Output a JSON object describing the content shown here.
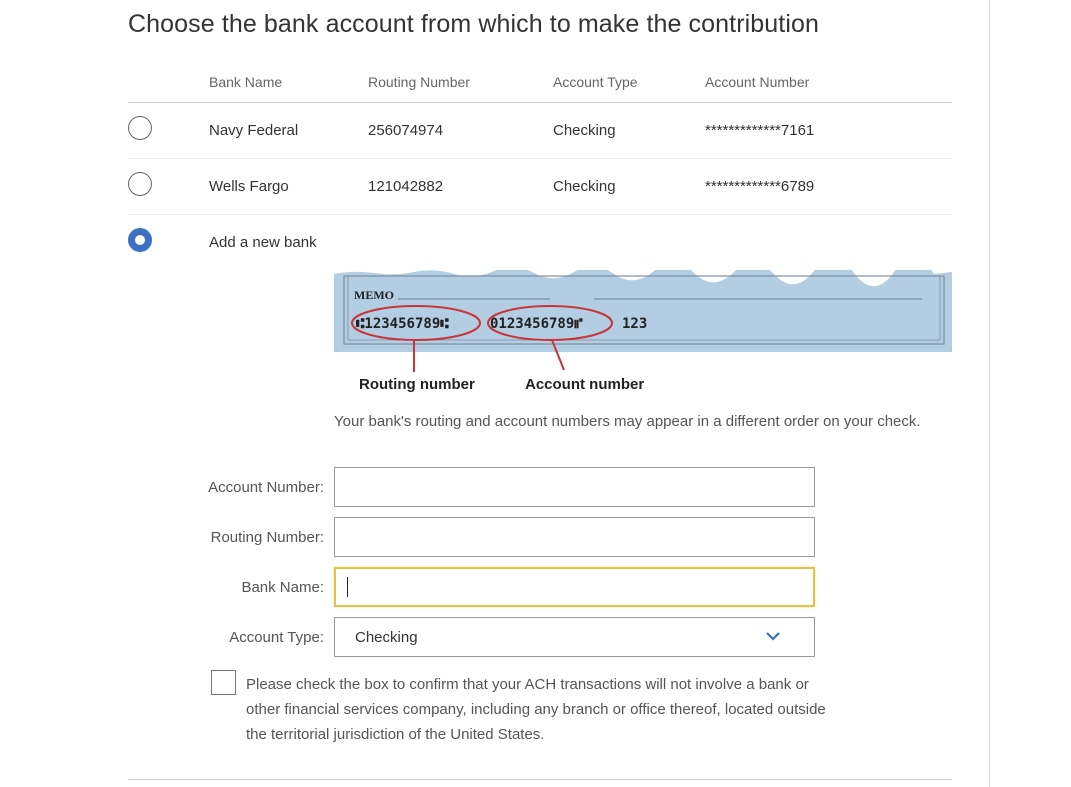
{
  "title": "Choose the bank account from which to make the contribution",
  "table": {
    "headers": [
      "Bank Name",
      "Routing Number",
      "Account Type",
      "Account Number"
    ],
    "rows": [
      {
        "bank": "Navy Federal",
        "routing": "256074974",
        "type": "Checking",
        "account": "*************7161",
        "selected": false
      },
      {
        "bank": "Wells Fargo",
        "routing": "121042882",
        "type": "Checking",
        "account": "*************6789",
        "selected": false
      }
    ],
    "add_new_label": "Add a new bank"
  },
  "check_image": {
    "memo": "MEMO",
    "micr_routing": "⑆123456789⑆",
    "micr_account": "0123456789⑈",
    "micr_check": "123",
    "routing_caption": "Routing number",
    "account_caption": "Account number"
  },
  "note": "Your bank's routing and account numbers may appear in a different order on your check.",
  "form": {
    "account_number_label": "Account Number:",
    "routing_number_label": "Routing Number:",
    "bank_name_label": "Bank Name:",
    "account_type_label": "Account Type:",
    "account_type_value": "Checking",
    "account_number_value": "",
    "routing_number_value": "",
    "bank_name_value": ""
  },
  "confirm_text": "Please check the box to confirm that your ACH transactions will not involve a bank or other financial services company, including any branch or office thereof, located outside the territorial jurisdiction of the United States.",
  "colors": {
    "accent": "#3d6fc2",
    "focus": "#e2c24a",
    "check_bg": "#b3cde3",
    "ellipse": "#c8343a"
  }
}
